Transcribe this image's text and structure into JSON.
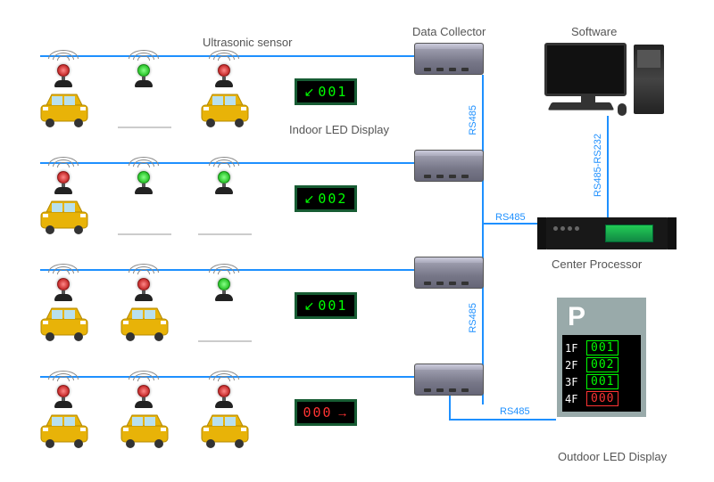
{
  "labels": {
    "ultrasonic": "Ultrasonic sensor",
    "data_collector": "Data Collector",
    "software": "Software",
    "indoor_led": "Indoor LED Display",
    "center_processor": "Center Processor",
    "outdoor_led": "Outdoor LED Display"
  },
  "bus": {
    "rs485": "RS485",
    "rs485_232": "RS485-RS232"
  },
  "rows": [
    {
      "sensors": [
        "red",
        "green",
        "red"
      ],
      "occupied": [
        true,
        false,
        true
      ],
      "display": {
        "value": "001",
        "arrow": "↙",
        "full": false
      }
    },
    {
      "sensors": [
        "red",
        "green",
        "green"
      ],
      "occupied": [
        true,
        false,
        false
      ],
      "display": {
        "value": "002",
        "arrow": "↙",
        "full": false
      }
    },
    {
      "sensors": [
        "red",
        "red",
        "green"
      ],
      "occupied": [
        true,
        true,
        false
      ],
      "display": {
        "value": "001",
        "arrow": "↙",
        "full": false
      }
    },
    {
      "sensors": [
        "red",
        "red",
        "red"
      ],
      "occupied": [
        true,
        true,
        true
      ],
      "display": {
        "value": "000",
        "arrow": "→",
        "full": true
      }
    }
  ],
  "outdoor": {
    "symbol": "P",
    "lines": [
      {
        "floor": "1F",
        "value": "001",
        "full": false
      },
      {
        "floor": "2F",
        "value": "002",
        "full": false
      },
      {
        "floor": "3F",
        "value": "001",
        "full": false
      },
      {
        "floor": "4F",
        "value": "000",
        "full": true
      }
    ]
  },
  "colors": {
    "wire": "#1e90ff",
    "led_ok": "#00ff00",
    "led_full": "#ff3333"
  }
}
